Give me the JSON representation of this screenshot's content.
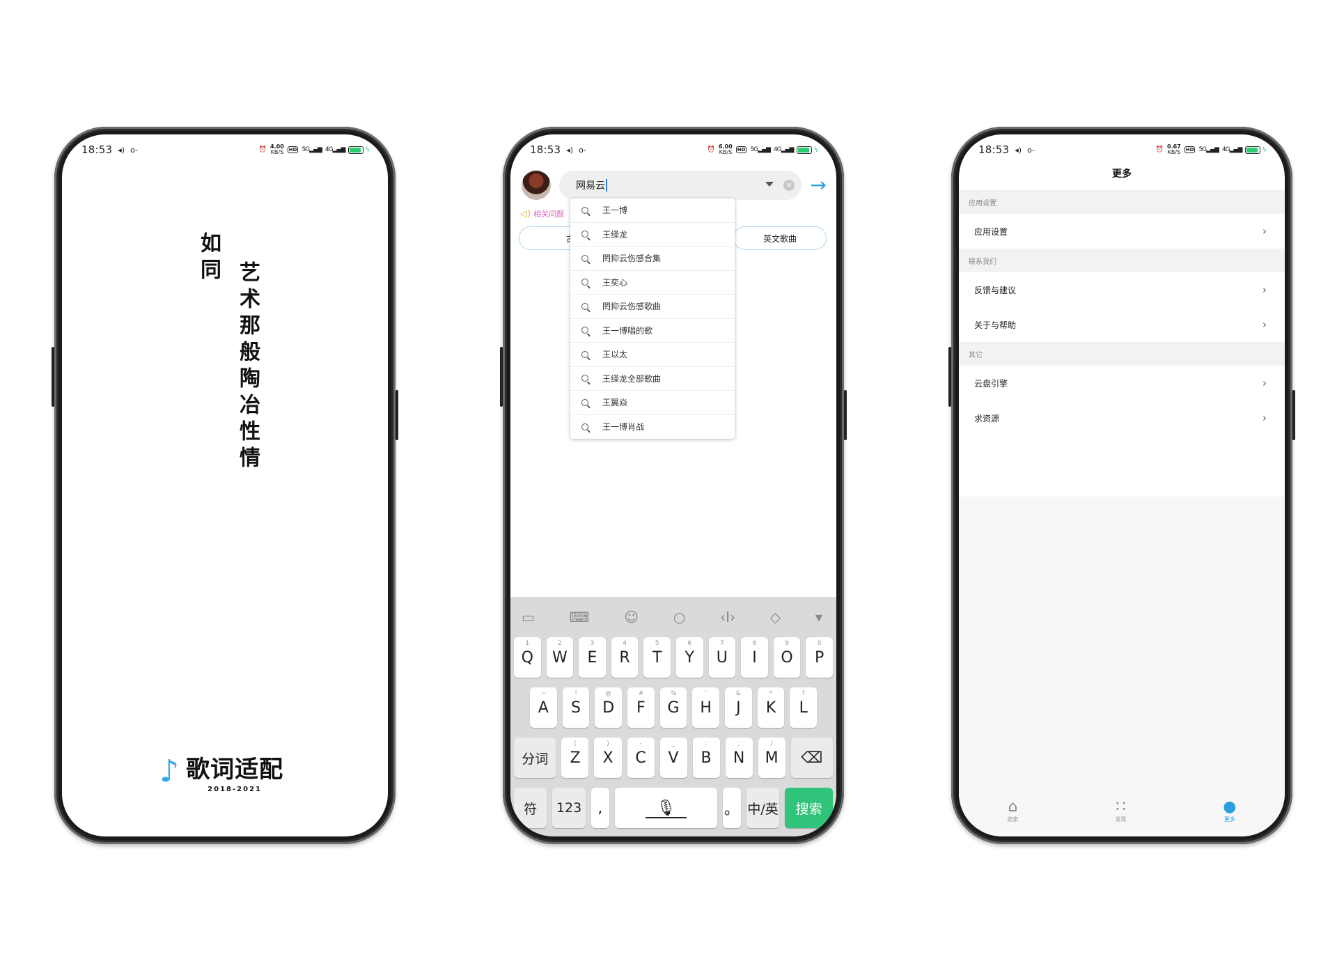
{
  "status_bar": {
    "time": "18:53",
    "speeds": [
      "4.00",
      "6.00",
      "0.67"
    ],
    "speed_unit": "KB/S",
    "hd": "HD",
    "signal1": "5G",
    "signal2": "4G"
  },
  "splash": {
    "line1": "如同",
    "line2": "艺术那般陶冶性情",
    "brand_name": "歌词适配",
    "years": "2018-2021"
  },
  "search": {
    "query": "网易云",
    "related_label": "相关问题",
    "chips": [
      "古风",
      "英文歌曲"
    ],
    "suggestions": [
      "王一博",
      "王绎龙",
      "罔抑云伤感合集",
      "王奕心",
      "罔抑云伤感歌曲",
      "王一博唱的歌",
      "王以太",
      "王绎龙全部歌曲",
      "王翼焱",
      "王一博肖战"
    ]
  },
  "keyboard": {
    "row1": [
      {
        "k": "Q",
        "s": "1"
      },
      {
        "k": "W",
        "s": "2"
      },
      {
        "k": "E",
        "s": "3"
      },
      {
        "k": "R",
        "s": "4"
      },
      {
        "k": "T",
        "s": "5"
      },
      {
        "k": "Y",
        "s": "6"
      },
      {
        "k": "U",
        "s": "7"
      },
      {
        "k": "I",
        "s": "8"
      },
      {
        "k": "O",
        "s": "9"
      },
      {
        "k": "P",
        "s": "0"
      }
    ],
    "row2": [
      {
        "k": "A",
        "s": "~"
      },
      {
        "k": "S",
        "s": "!"
      },
      {
        "k": "D",
        "s": "@"
      },
      {
        "k": "F",
        "s": "#"
      },
      {
        "k": "G",
        "s": "%"
      },
      {
        "k": "H",
        "s": "'"
      },
      {
        "k": "J",
        "s": "&"
      },
      {
        "k": "K",
        "s": "*"
      },
      {
        "k": "L",
        "s": "?"
      }
    ],
    "row3_left": "分词",
    "row3": [
      {
        "k": "Z",
        "s": "("
      },
      {
        "k": "X",
        "s": ")"
      },
      {
        "k": "C",
        "s": "-"
      },
      {
        "k": "V",
        "s": "_"
      },
      {
        "k": "B",
        "s": ":"
      },
      {
        "k": "N",
        "s": ";"
      },
      {
        "k": "M",
        "s": "/"
      }
    ],
    "symbols": "符",
    "numbers": "123",
    "comma": ",",
    "period": "。",
    "lang": "中/英",
    "search": "搜索"
  },
  "more": {
    "title": "更多",
    "sections": [
      {
        "header": "应用设置",
        "rows": [
          "应用设置"
        ]
      },
      {
        "header": "联系我们",
        "rows": [
          "反馈与建议",
          "关于与帮助"
        ]
      },
      {
        "header": "其它",
        "rows": [
          "云盘引擎",
          "求资源"
        ]
      }
    ],
    "tabs": [
      {
        "label": "搜索",
        "icon": "home-icon"
      },
      {
        "label": "发现",
        "icon": "grid-icon"
      },
      {
        "label": "更多",
        "icon": "user-icon",
        "active": true
      }
    ]
  },
  "colors": {
    "accent_blue": "#2a9fe0",
    "search_green": "#2fc47a",
    "related_pink": "#e05abf",
    "chip_border": "#a8d8f0"
  }
}
